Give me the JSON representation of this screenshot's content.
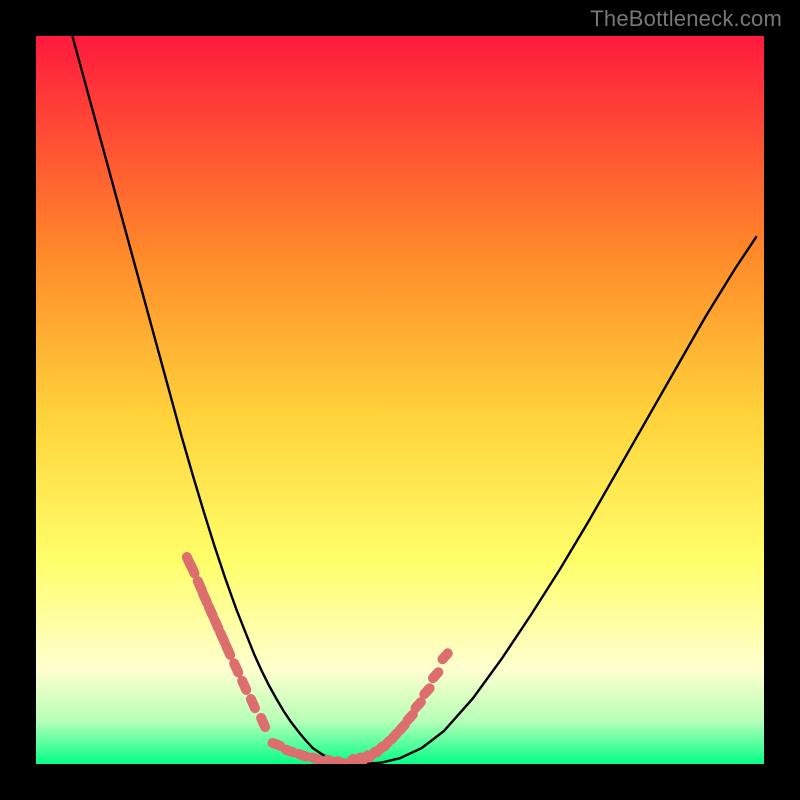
{
  "watermark": "TheBottleneck.com",
  "colors": {
    "frame": "#000000",
    "gradient_top": "#ff1a3d",
    "gradient_mid_upper": "#ff8a2a",
    "gradient_mid": "#ffd23a",
    "gradient_mid_lower": "#ffff6a",
    "gradient_pale": "#ffffcf",
    "gradient_green_pale": "#b8ffb8",
    "gradient_green": "#05ff87",
    "curve": "#000000",
    "dots": "#dd6e6e"
  },
  "chart_data": {
    "type": "line",
    "title": "",
    "xlabel": "",
    "ylabel": "",
    "xlim": [
      0,
      1
    ],
    "ylim": [
      0,
      1
    ],
    "series": [
      {
        "name": "bottleneck-curve",
        "x": [
          0.05,
          0.065,
          0.08,
          0.095,
          0.11,
          0.125,
          0.14,
          0.155,
          0.17,
          0.185,
          0.2,
          0.215,
          0.23,
          0.245,
          0.26,
          0.275,
          0.29,
          0.3,
          0.31,
          0.32,
          0.33,
          0.34,
          0.35,
          0.36,
          0.37,
          0.38,
          0.395,
          0.41,
          0.43,
          0.45,
          0.475,
          0.5,
          0.53,
          0.56,
          0.6,
          0.64,
          0.68,
          0.72,
          0.76,
          0.8,
          0.84,
          0.88,
          0.92,
          0.96,
          0.99
        ],
        "values": [
          1.0,
          0.945,
          0.89,
          0.835,
          0.78,
          0.725,
          0.67,
          0.615,
          0.56,
          0.505,
          0.45,
          0.398,
          0.348,
          0.3,
          0.255,
          0.213,
          0.175,
          0.15,
          0.128,
          0.108,
          0.09,
          0.073,
          0.058,
          0.045,
          0.033,
          0.022,
          0.012,
          0.006,
          0.002,
          0.0,
          0.002,
          0.008,
          0.022,
          0.045,
          0.09,
          0.145,
          0.205,
          0.268,
          0.335,
          0.405,
          0.475,
          0.545,
          0.615,
          0.68,
          0.725
        ]
      }
    ],
    "dots": {
      "name": "highlight-dots",
      "x_left": [
        0.21,
        0.215,
        0.225,
        0.232,
        0.24,
        0.248,
        0.256,
        0.264,
        0.275,
        0.286,
        0.298,
        0.312
      ],
      "y_left": [
        0.278,
        0.268,
        0.245,
        0.228,
        0.21,
        0.192,
        0.174,
        0.156,
        0.132,
        0.108,
        0.083,
        0.057
      ],
      "x_bottom": [
        0.33,
        0.348,
        0.366,
        0.385,
        0.405,
        0.42
      ],
      "y_bottom": [
        0.027,
        0.018,
        0.012,
        0.007,
        0.004,
        0.002
      ],
      "x_right": [
        0.432,
        0.442,
        0.452,
        0.462,
        0.472,
        0.482,
        0.492,
        0.503,
        0.514,
        0.525,
        0.537,
        0.549,
        0.562
      ],
      "y_right": [
        0.003,
        0.005,
        0.008,
        0.013,
        0.02,
        0.028,
        0.038,
        0.05,
        0.064,
        0.081,
        0.1,
        0.122,
        0.148
      ]
    }
  }
}
